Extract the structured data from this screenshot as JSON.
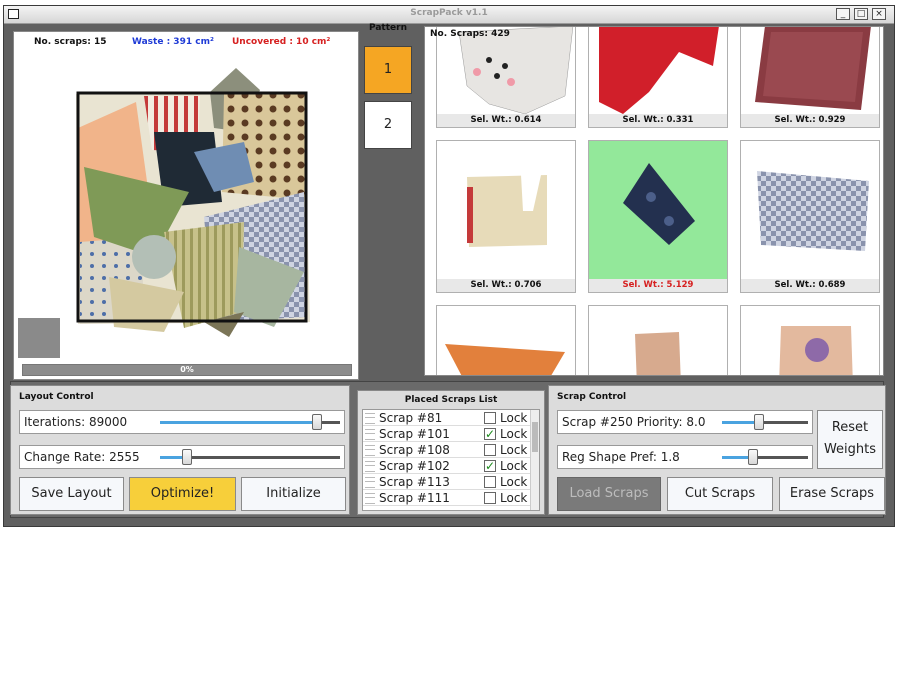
{
  "window": {
    "title": "ScrapPack v1.1",
    "controls": {
      "minimize": "_",
      "maximize": "□",
      "close": "×"
    }
  },
  "layout": {
    "stats": {
      "scraps": "No. scraps: 15",
      "waste": "Waste : 391 cm²",
      "uncovered": "Uncovered : 10 cm²"
    },
    "progress_label": "0%",
    "progress_value": 0
  },
  "pattern": {
    "header": "Pattern",
    "items": [
      {
        "label": "1",
        "selected": true
      },
      {
        "label": "2",
        "selected": false
      }
    ]
  },
  "scrap_grid": {
    "count": "No. Scraps: 429",
    "cells": [
      {
        "weight": "Sel. Wt.: 0.614",
        "highlight": false
      },
      {
        "weight": "Sel. Wt.: 0.331",
        "highlight": false
      },
      {
        "weight": "Sel. Wt.: 0.929",
        "highlight": false
      },
      {
        "weight": "Sel. Wt.: 0.706",
        "highlight": false
      },
      {
        "weight": "Sel. Wt.: 5.129",
        "highlight": true
      },
      {
        "weight": "Sel. Wt.: 0.689",
        "highlight": false
      }
    ]
  },
  "layout_control": {
    "title": "Layout Control",
    "iterations_label": "Iterations: 89000",
    "iterations_value": 0.92,
    "change_rate_label": "Change Rate: 2555",
    "change_rate_value": 0.1,
    "save_label": "Save Layout",
    "optimize_label": "Optimize!",
    "initialize_label": "Initialize"
  },
  "placed_list": {
    "title": "Placed Scraps List",
    "lock_label": "Lock",
    "items": [
      {
        "name": "Scrap #81",
        "locked": false
      },
      {
        "name": "Scrap #101",
        "locked": true
      },
      {
        "name": "Scrap #108",
        "locked": false
      },
      {
        "name": "Scrap #102",
        "locked": true
      },
      {
        "name": "Scrap #113",
        "locked": false
      },
      {
        "name": "Scrap #111",
        "locked": false
      }
    ]
  },
  "scrap_control": {
    "title": "Scrap Control",
    "priority_label": "Scrap #250 Priority: 8.0",
    "priority_value": 0.42,
    "shape_label": "Reg Shape Pref: 1.8",
    "shape_value": 0.35,
    "reset_label": "Reset Weights",
    "load_label": "Load Scraps",
    "cut_label": "Cut Scraps",
    "erase_label": "Erase Scraps"
  },
  "colors": {
    "waste": "#1f3bd6",
    "uncovered": "#d62020",
    "optimize_button": "#f7cf3a",
    "pattern_selected": "#f5a623",
    "highlight_cell": "#93e89a",
    "highlight_weight": "#d62020",
    "slider_fill": "#4aa3e0"
  }
}
